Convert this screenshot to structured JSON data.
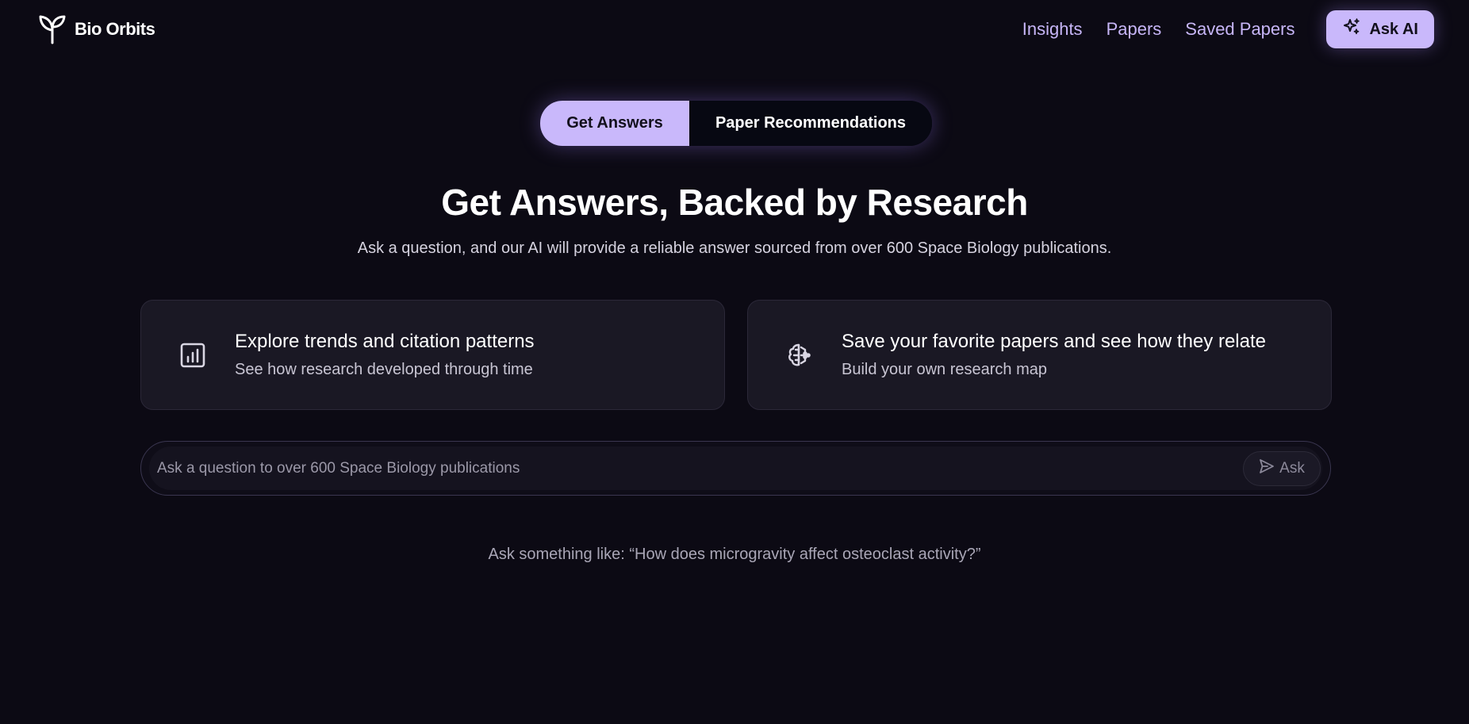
{
  "header": {
    "brand_name": "Bio Orbits",
    "brand_icon": "sprout-icon",
    "nav": [
      {
        "label": "Insights"
      },
      {
        "label": "Papers"
      },
      {
        "label": "Saved Papers"
      }
    ],
    "ask_ai_label": "Ask AI",
    "ask_ai_icon": "sparkles-icon"
  },
  "toggle": {
    "active_label": "Get Answers",
    "inactive_label": "Paper Recommendations"
  },
  "hero": {
    "title": "Get Answers, Backed by Research",
    "subtitle": "Ask a question, and our AI will provide a reliable answer sourced from over 600 Space Biology publications."
  },
  "cards": [
    {
      "icon": "bar-chart-icon",
      "title": "Explore trends and citation patterns",
      "subtitle": "See how research developed through time"
    },
    {
      "icon": "brain-icon",
      "title": "Save your favorite papers and see how they relate",
      "subtitle": "Build your own research map"
    }
  ],
  "search": {
    "placeholder": "Ask a question to over 600 Space Biology publications",
    "value": "",
    "ask_label": "Ask",
    "ask_icon": "send-icon"
  },
  "suggestion": "Ask something like: “How does microgravity affect osteoclast activity?”",
  "colors": {
    "background": "#0c0a14",
    "accent": "#c9b8fb",
    "nav_link": "#c7b6f7",
    "card_bg": "#1a1824"
  }
}
